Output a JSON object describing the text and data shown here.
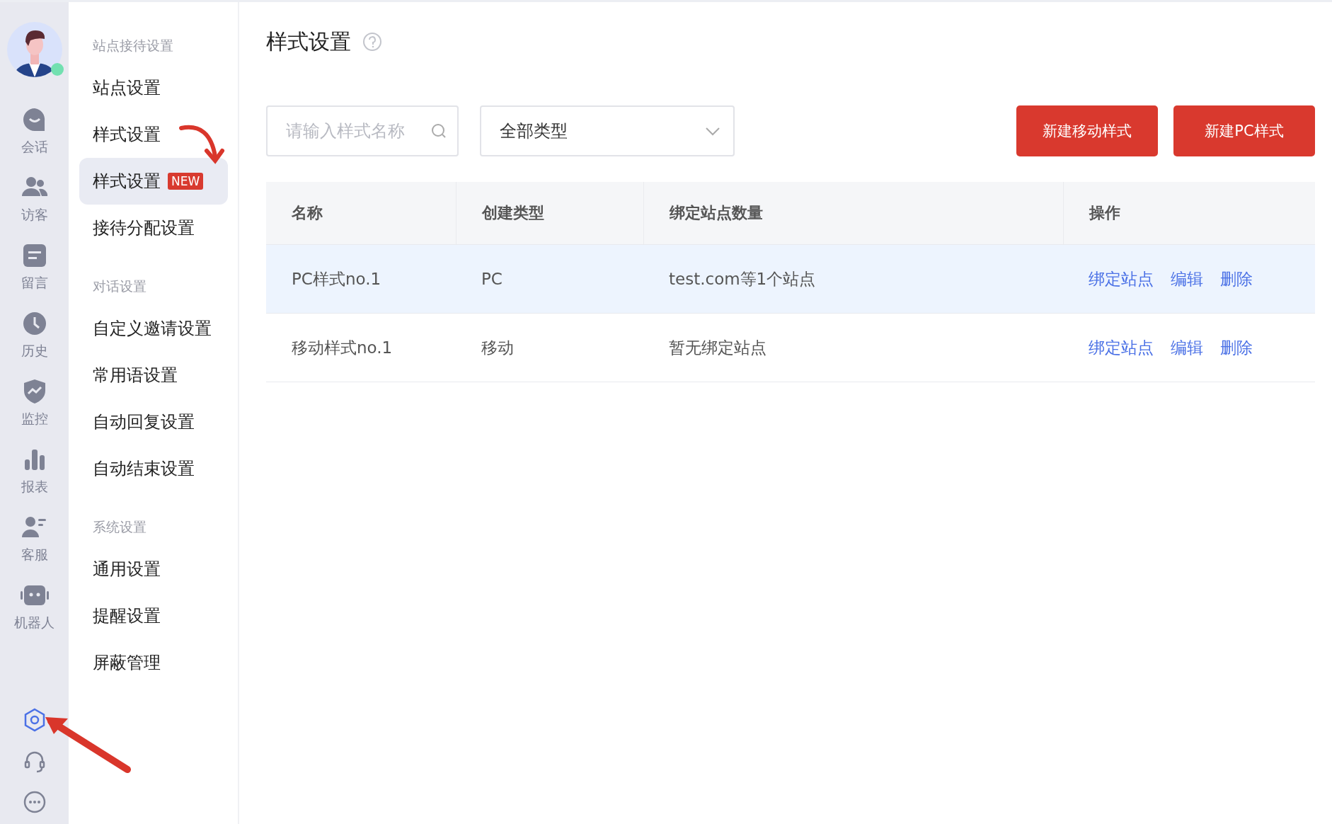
{
  "rail": {
    "avatar": {
      "online": true
    },
    "items": [
      {
        "label": "会话"
      },
      {
        "label": "访客"
      },
      {
        "label": "留言"
      },
      {
        "label": "历史"
      },
      {
        "label": "监控"
      },
      {
        "label": "报表"
      },
      {
        "label": "客服"
      },
      {
        "label": "机器人"
      }
    ],
    "bottom": [
      {
        "selected": true
      },
      {
        "selected": false
      },
      {
        "selected": false
      }
    ]
  },
  "submenu": [
    {
      "title": "站点接待设置",
      "items": [
        {
          "label": "站点设置",
          "selected": false
        },
        {
          "label": "样式设置",
          "selected": false
        },
        {
          "label": "样式设置",
          "badge": "NEW",
          "selected": true
        },
        {
          "label": "接待分配设置",
          "selected": false
        }
      ]
    },
    {
      "title": "对话设置",
      "items": [
        {
          "label": "自定义邀请设置",
          "selected": false
        },
        {
          "label": "常用语设置",
          "selected": false
        },
        {
          "label": "自动回复设置",
          "selected": false
        },
        {
          "label": "自动结束设置",
          "selected": false
        }
      ]
    },
    {
      "title": "系统设置",
      "items": [
        {
          "label": "通用设置",
          "selected": false
        },
        {
          "label": "提醒设置",
          "selected": false
        },
        {
          "label": "屏蔽管理",
          "selected": false
        }
      ]
    }
  ],
  "page": {
    "title": "样式设置",
    "search": {
      "placeholder": "请输入样式名称"
    },
    "type_select": {
      "value": "全部类型"
    },
    "buttons": [
      "新建移动样式",
      "新建PC样式"
    ]
  },
  "table": {
    "columns": [
      "名称",
      "创建类型",
      "绑定站点数量",
      "操作"
    ],
    "rows": [
      {
        "name": "PC样式no.1",
        "type": "PC",
        "sites": "test.com等1个站点",
        "actions": [
          "绑定站点",
          "编辑",
          "删除"
        ],
        "selected": true
      },
      {
        "name": "移动样式no.1",
        "type": "移动",
        "sites": "暂无绑定站点",
        "actions": [
          "绑定站点",
          "编辑",
          "删除"
        ],
        "selected": false
      }
    ]
  }
}
